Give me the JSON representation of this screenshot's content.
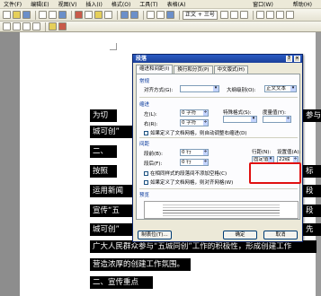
{
  "menu": [
    "文件(F)",
    "编辑(E)",
    "视图(V)",
    "插入(I)",
    "格式(O)",
    "工具(T)",
    "表格(A)",
    "窗口(W)",
    "帮助(H)"
  ],
  "toolbar": {
    "style": "正文 + 三号"
  },
  "dialog": {
    "title": "段落",
    "close_glyph": "×",
    "help_glyph": "?",
    "tabs": [
      "缩进和间距(I)",
      "换行和分页(P)",
      "中文版式(H)"
    ],
    "general_section": "常规",
    "alignment_label": "对齐方式(G):",
    "outline_label": "大纲级别(O):",
    "outline_value": "正文文本",
    "indent_section": "缩进",
    "left_label": "左(L):",
    "left_value": "0 字符",
    "right_label": "右(R):",
    "right_value": "0 字符",
    "special_label": "特殊格式(S):",
    "by_label": "度量值(Y):",
    "mirror_indent": "如果定义了文档网格，则自动调整右缩进(D)",
    "spacing_section": "间距",
    "before_label": "段前(B):",
    "before_value": "0 行",
    "after_label": "段后(F):",
    "after_value": "0 行",
    "line_spacing_label": "行距(N):",
    "line_spacing_value": "固定值",
    "at_label": "设置值(A):",
    "at_value": "22磅",
    "no_space_same_style": "在相同样式的段落间不添加空格(C)",
    "snap_to_grid": "如果定义了文档网格，则对齐网格(W)",
    "preview_section": "预览",
    "tabs_button": "制表位(T)...",
    "ok_button": "确定",
    "cancel_button": "取消"
  },
  "doc": {
    "lines": [
      "为切",
      "城可创”",
      "二、",
      "按照",
      "运用新闻",
      "宣传“五",
      "城可创”",
      "广大人民群众参与“五城同创”工作的积极性，形成创建工作",
      "营造浓厚的创建工作氛围。",
      "二、宣传重点"
    ],
    "fragments": [
      "参与",
      "标",
      "段",
      "段",
      "先"
    ]
  }
}
